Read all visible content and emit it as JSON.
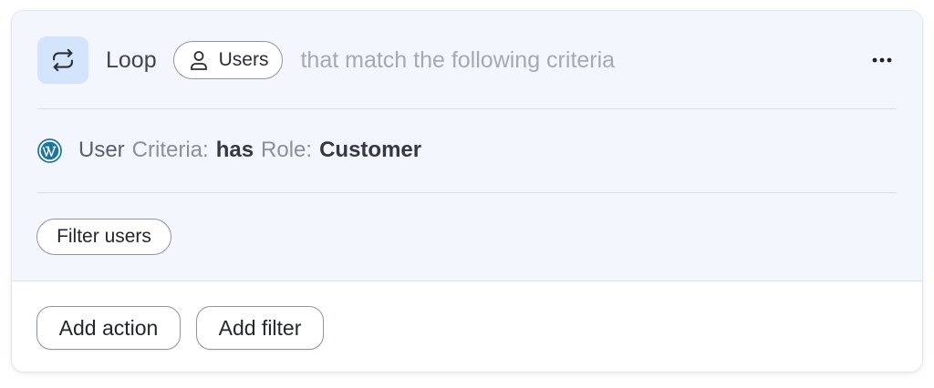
{
  "step": {
    "title": "Loop",
    "entity_pill": {
      "label": "Users",
      "icon": "person-icon"
    },
    "criteria_text": "that match the following criteria",
    "more_icon": "more-horizontal-icon",
    "loop_icon": "loop-arrows-icon",
    "loop_icon_bg": "#d3e4fc"
  },
  "criteria": {
    "source_icon": "wordpress-icon",
    "user_label": "User",
    "criteria_label": "Criteria:",
    "operator": "has",
    "field_label": "Role:",
    "value": "Customer"
  },
  "filter_button": {
    "label": "Filter users"
  },
  "footer": {
    "add_action_label": "Add action",
    "add_filter_label": "Add filter"
  },
  "colors": {
    "body_bg": "#f4f6fd",
    "border": "#8f949f",
    "accent_icon": "#21759b"
  }
}
